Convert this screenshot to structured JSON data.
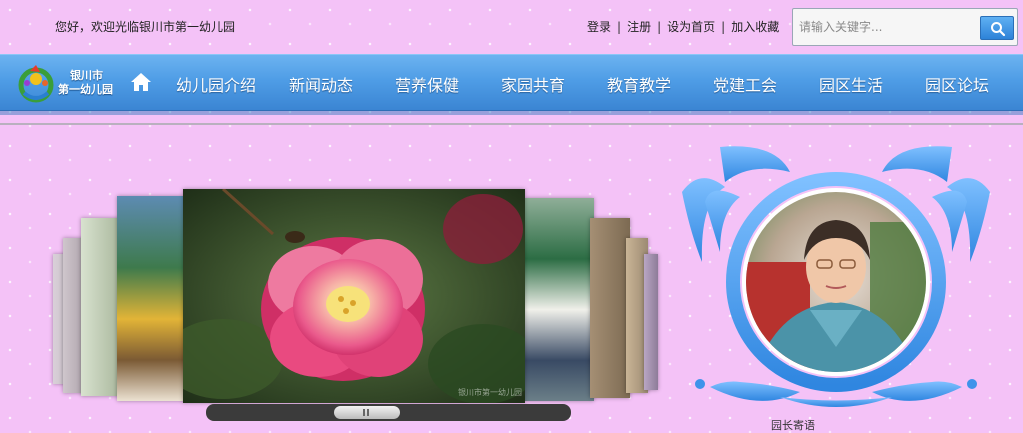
{
  "header": {
    "welcome": "您好，欢迎光临银川市第一幼儿园",
    "links": [
      "登录",
      "注册",
      "设为首页",
      "加入收藏"
    ],
    "search_placeholder": "请输入关键字..."
  },
  "nav": {
    "logo_line1": "银川市",
    "logo_line2": "第一幼儿园",
    "items": [
      "幼儿园介绍",
      "新闻动态",
      "营养保健",
      "家园共育",
      "教育教学",
      "党建工会",
      "园区生活",
      "园区论坛"
    ]
  },
  "slider": {
    "watermark": "银川市第一幼儿园"
  },
  "colors": {
    "page_bg": "#f4c2f7",
    "nav_blue": "#4f9de6",
    "frame_blue": "#4a9ef0"
  }
}
